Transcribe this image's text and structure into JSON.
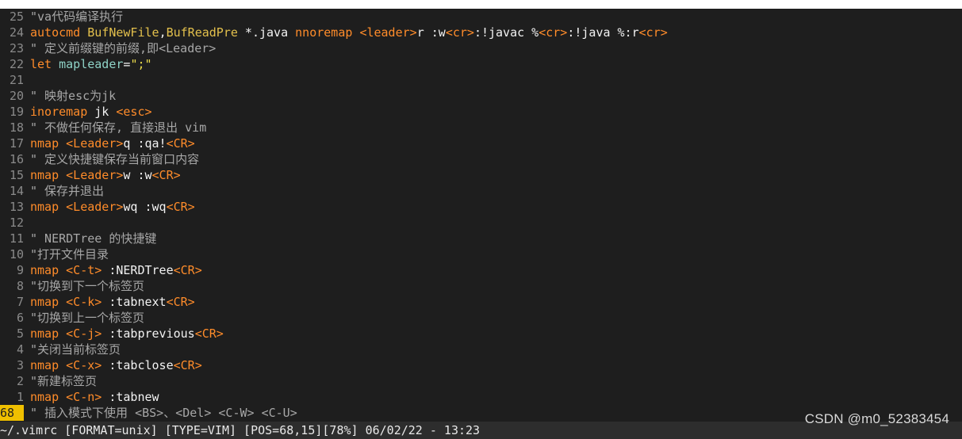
{
  "editor": {
    "lines": [
      {
        "n": "25",
        "parts": [
          {
            "c": "c-comment",
            "t": "\"va代码编译执行"
          }
        ]
      },
      {
        "n": "24",
        "parts": [
          {
            "c": "c-orange",
            "t": "autocmd "
          },
          {
            "c": "c-yellow",
            "t": "BufNewFile"
          },
          {
            "c": "c-white",
            "t": ","
          },
          {
            "c": "c-yellow",
            "t": "BufReadPre"
          },
          {
            "c": "c-white",
            "t": " *.java "
          },
          {
            "c": "c-orange",
            "t": "nnoremap "
          },
          {
            "c": "c-orange",
            "t": "<leader>"
          },
          {
            "c": "c-white",
            "t": "r :w"
          },
          {
            "c": "c-orange",
            "t": "<cr>"
          },
          {
            "c": "c-white",
            "t": ":!javac %"
          },
          {
            "c": "c-orange",
            "t": "<cr>"
          },
          {
            "c": "c-white",
            "t": ":!java %:r"
          },
          {
            "c": "c-orange",
            "t": "<cr>"
          }
        ]
      },
      {
        "n": "23",
        "parts": [
          {
            "c": "c-comment",
            "t": "\" 定义前缀键的前缀,即<Leader>"
          }
        ]
      },
      {
        "n": "22",
        "parts": [
          {
            "c": "c-orange",
            "t": "let "
          },
          {
            "c": "c-teal",
            "t": "mapleader"
          },
          {
            "c": "c-white",
            "t": "="
          },
          {
            "c": "c-green",
            "t": "\";\""
          }
        ]
      },
      {
        "n": "21",
        "parts": []
      },
      {
        "n": "20",
        "parts": [
          {
            "c": "c-comment",
            "t": "\" 映射esc为jk"
          }
        ]
      },
      {
        "n": "19",
        "parts": [
          {
            "c": "c-orange",
            "t": "inoremap "
          },
          {
            "c": "c-white",
            "t": "jk "
          },
          {
            "c": "c-orange",
            "t": "<esc>"
          }
        ]
      },
      {
        "n": "18",
        "parts": [
          {
            "c": "c-comment",
            "t": "\" 不做任何保存, 直接退出 vim"
          }
        ]
      },
      {
        "n": "17",
        "parts": [
          {
            "c": "c-orange",
            "t": "nmap "
          },
          {
            "c": "c-orange",
            "t": "<Leader>"
          },
          {
            "c": "c-white",
            "t": "q :qa!"
          },
          {
            "c": "c-orange",
            "t": "<CR>"
          }
        ]
      },
      {
        "n": "16",
        "parts": [
          {
            "c": "c-comment",
            "t": "\" 定义快捷键保存当前窗口内容"
          }
        ]
      },
      {
        "n": "15",
        "parts": [
          {
            "c": "c-orange",
            "t": "nmap "
          },
          {
            "c": "c-orange",
            "t": "<Leader>"
          },
          {
            "c": "c-white",
            "t": "w :w"
          },
          {
            "c": "c-orange",
            "t": "<CR>"
          }
        ]
      },
      {
        "n": "14",
        "parts": [
          {
            "c": "c-comment",
            "t": "\" 保存并退出"
          }
        ]
      },
      {
        "n": "13",
        "parts": [
          {
            "c": "c-orange",
            "t": "nmap "
          },
          {
            "c": "c-orange",
            "t": "<Leader>"
          },
          {
            "c": "c-white",
            "t": "wq :wq"
          },
          {
            "c": "c-orange",
            "t": "<CR>"
          }
        ]
      },
      {
        "n": "12",
        "parts": []
      },
      {
        "n": "11",
        "parts": [
          {
            "c": "c-comment",
            "t": "\" NERDTree 的快捷键"
          }
        ]
      },
      {
        "n": "10",
        "parts": [
          {
            "c": "c-comment",
            "t": "\"打开文件目录"
          }
        ]
      },
      {
        "n": "9",
        "parts": [
          {
            "c": "c-orange",
            "t": "nmap "
          },
          {
            "c": "c-orange",
            "t": "<C-t>"
          },
          {
            "c": "c-white",
            "t": " :NERDTree"
          },
          {
            "c": "c-orange",
            "t": "<CR>"
          }
        ]
      },
      {
        "n": "8",
        "parts": [
          {
            "c": "c-comment",
            "t": "\"切换到下一个标签页"
          }
        ]
      },
      {
        "n": "7",
        "parts": [
          {
            "c": "c-orange",
            "t": "nmap "
          },
          {
            "c": "c-orange",
            "t": "<C-k>"
          },
          {
            "c": "c-white",
            "t": " :tabnext"
          },
          {
            "c": "c-orange",
            "t": "<CR>"
          }
        ]
      },
      {
        "n": "6",
        "parts": [
          {
            "c": "c-comment",
            "t": "\"切换到上一个标签页"
          }
        ]
      },
      {
        "n": "5",
        "parts": [
          {
            "c": "c-orange",
            "t": "nmap "
          },
          {
            "c": "c-orange",
            "t": "<C-j>"
          },
          {
            "c": "c-white",
            "t": " :tabprevious"
          },
          {
            "c": "c-orange",
            "t": "<CR>"
          }
        ]
      },
      {
        "n": "4",
        "parts": [
          {
            "c": "c-comment",
            "t": "\"关闭当前标签页"
          }
        ]
      },
      {
        "n": "3",
        "parts": [
          {
            "c": "c-orange",
            "t": "nmap "
          },
          {
            "c": "c-orange",
            "t": "<C-x>"
          },
          {
            "c": "c-white",
            "t": " :tabclose"
          },
          {
            "c": "c-orange",
            "t": "<CR>"
          }
        ]
      },
      {
        "n": "2",
        "parts": [
          {
            "c": "c-comment",
            "t": "\"新建标签页"
          }
        ]
      },
      {
        "n": "1",
        "parts": [
          {
            "c": "c-orange",
            "t": "nmap "
          },
          {
            "c": "c-orange",
            "t": "<C-n>"
          },
          {
            "c": "c-white",
            "t": " :tabnew"
          }
        ]
      },
      {
        "n": "68",
        "current": true,
        "parts": [
          {
            "c": "c-comment",
            "t": "\" 插入模式下使用 <BS>、<Del> <C-W> <C-U>"
          }
        ]
      }
    ]
  },
  "statusline": {
    "text": "~/.vimrc [FORMAT=unix] [TYPE=VIM] [POS=68,15][78%] 06/02/22 - 13:23"
  },
  "watermark": {
    "text": "CSDN @m0_52383454"
  },
  "colors": {
    "background": "#1e1e1e",
    "keyword": "#ff8c2a",
    "event": "#e3c04c",
    "comment": "#a7a7a7",
    "current_line_number": "#f0c000"
  }
}
